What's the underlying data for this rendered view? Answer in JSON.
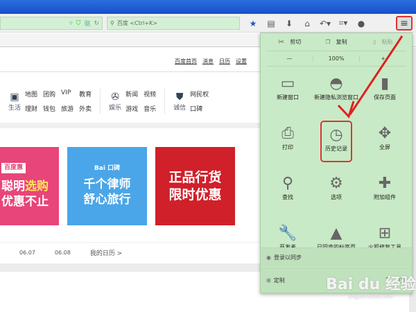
{
  "toolbar": {
    "search_placeholder": "百度 <Ctrl+K>",
    "url_badge": "驱"
  },
  "page": {
    "header_links": [
      "百度首页",
      "消息",
      "日历",
      "设置"
    ],
    "nav_groups": [
      {
        "title": "生活",
        "links": [
          "地图",
          "团购",
          "VIP",
          "教育",
          "理财",
          "钱包",
          "旅游",
          "外卖"
        ]
      },
      {
        "title": "娱乐",
        "links": [
          "新闻",
          "视频",
          "游戏",
          "音乐"
        ]
      },
      {
        "title": "诚信",
        "links": [
          "网民权",
          "口碑"
        ]
      }
    ],
    "banners": [
      {
        "tag": "百度惠",
        "line1": "聪明",
        "line1_hl": "选购",
        "line2": "优惠不止"
      },
      {
        "tag": "Bai 口碑",
        "line1": "千个律师",
        "line2": "舒心旅行"
      },
      {
        "line1": "正品行货",
        "line2": "限时优惠"
      }
    ],
    "calendar": {
      "dates": [
        "06.07",
        "06.08"
      ],
      "my_calendar": "我的日历 >",
      "add": "+"
    }
  },
  "menu": {
    "cut": "剪切",
    "copy": "复制",
    "paste": "粘贴",
    "zoom_out": "—",
    "zoom_level": "100%",
    "zoom_in": "+",
    "items": [
      {
        "label": "新建窗口",
        "icon": "▭"
      },
      {
        "label": "新建隐私浏览窗口",
        "icon": "◓"
      },
      {
        "label": "保存页面",
        "icon": "▮"
      },
      {
        "label": "打印",
        "icon": "⎙"
      },
      {
        "label": "历史记录",
        "icon": "◷"
      },
      {
        "label": "全屏",
        "icon": "✥"
      },
      {
        "label": "查找",
        "icon": "⚲"
      },
      {
        "label": "选项",
        "icon": "⚙"
      },
      {
        "label": "附加组件",
        "icon": "✚"
      },
      {
        "label": "开发者",
        "icon": "🔧"
      },
      {
        "label": "已同步的标签页",
        "icon": "▲"
      },
      {
        "label": "火狐修复工具",
        "icon": "⊞"
      }
    ],
    "sign_in_sync": "登录以同步",
    "customize": "定制"
  },
  "watermark": {
    "text": "Bai du 经验",
    "sub": "jingyan.baidu.com"
  },
  "colors": {
    "panel": "#c9eac6",
    "highlight": "#dd3333",
    "title": "#1f5fd6"
  }
}
